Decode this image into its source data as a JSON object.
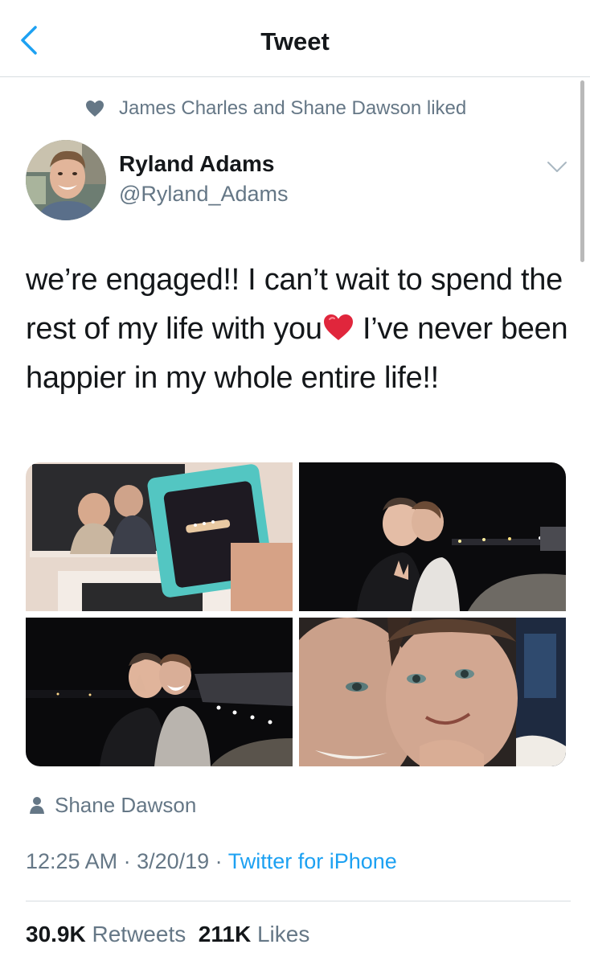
{
  "nav": {
    "back_icon": "chevron-left-icon",
    "title": "Tweet"
  },
  "social_context": {
    "icon": "heart-icon",
    "text": "James Charles and Shane Dawson liked"
  },
  "author": {
    "name": "Ryland Adams",
    "handle": "@Ryland_Adams",
    "menu_icon": "chevron-down-icon"
  },
  "tweet": {
    "text_part1": "we’re engaged!! I can’t wait to spend the rest of my life with you",
    "emoji": "red-heart-emoji",
    "text_part2": " I’ve never been happier in my whole entire life!!"
  },
  "media": {
    "count": 4
  },
  "tagged": {
    "icon": "person-icon",
    "name": "Shane Dawson"
  },
  "meta": {
    "time": "12:25 AM",
    "sep1": " · ",
    "date": "3/20/19",
    "sep2": " · ",
    "source": "Twitter for iPhone"
  },
  "stats": {
    "retweets_count": "30.9K",
    "retweets_label": "Retweets",
    "likes_count": "211K",
    "likes_label": "Likes"
  },
  "colors": {
    "accent": "#1da1f2",
    "secondary_text": "#657786",
    "primary_text": "#14171a",
    "divider": "#d7dde1"
  }
}
